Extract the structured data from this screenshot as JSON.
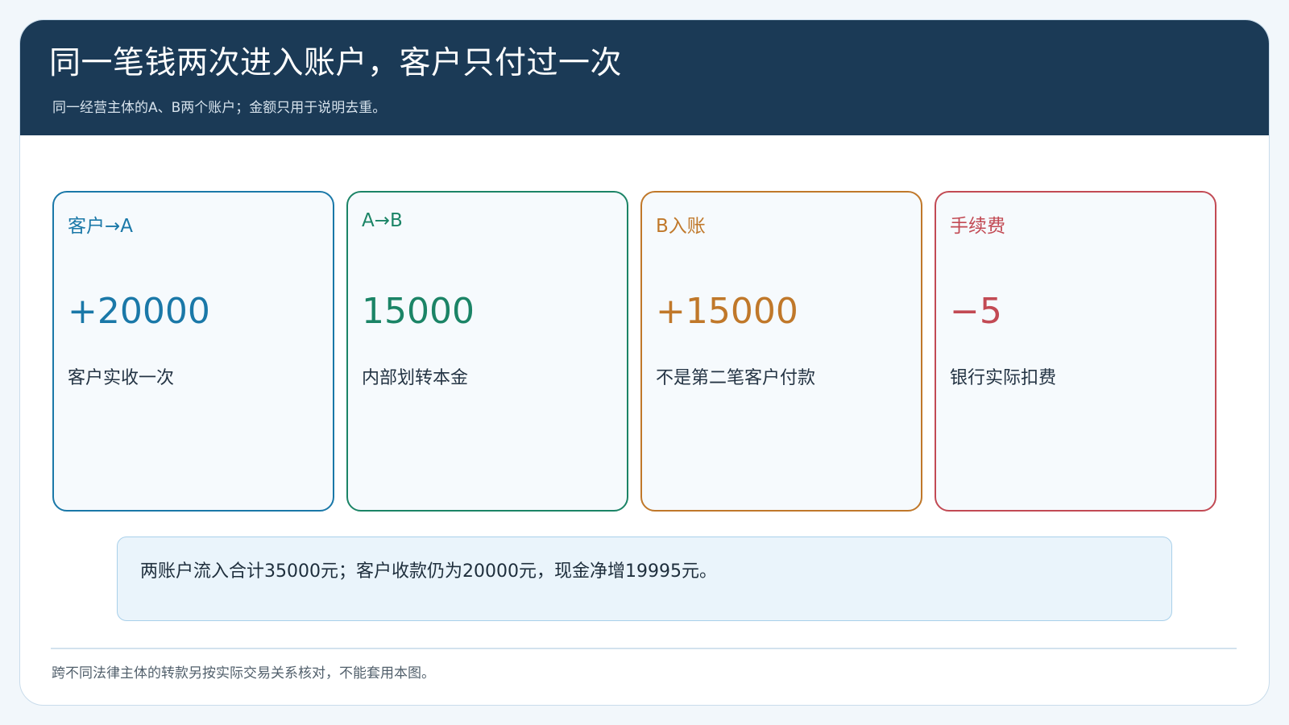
{
  "header": {
    "title": "同一笔钱两次进入账户，客户只付过一次",
    "subtitle": "同一经营主体的A、B两个账户；金额只用于说明去重。"
  },
  "cards": [
    {
      "label": "客户→A",
      "value": "+20000",
      "desc": "客户实收一次",
      "color": "#1a78a8"
    },
    {
      "label": "A→B",
      "value": "15000",
      "desc": "内部划转本金",
      "color": "#1b8466"
    },
    {
      "label": "B入账",
      "value": "+15000",
      "desc": "不是第二笔客户付款",
      "color": "#c0782a"
    },
    {
      "label": "手续费",
      "value": "−5",
      "desc": "银行实际扣费",
      "color": "#c24a54"
    }
  ],
  "summary": {
    "text": "两账户流入合计35000元；客户收款仍为20000元，现金净增19995元。"
  },
  "footnote": "跨不同法律主体的转款另按实际交易关系核对，不能套用本图。"
}
